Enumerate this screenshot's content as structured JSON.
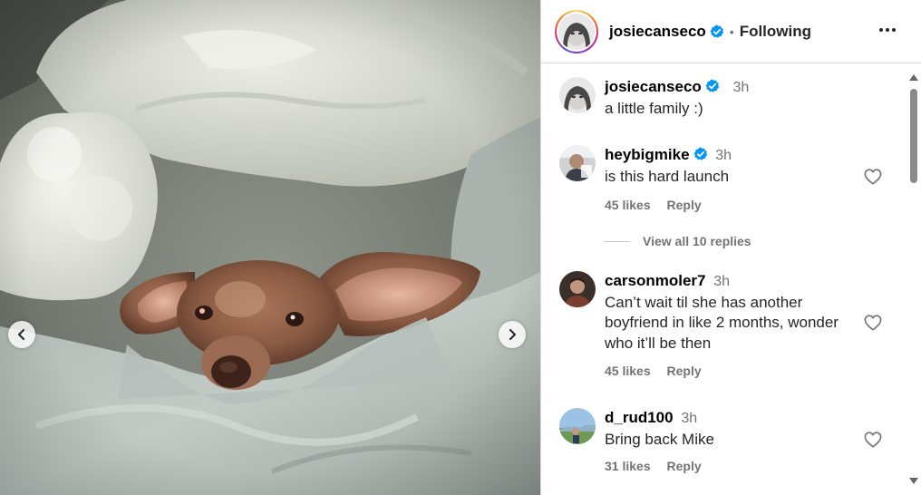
{
  "header": {
    "username": "josiecanseco",
    "separator": "•",
    "follow_label": "Following"
  },
  "caption": {
    "username": "josiecanseco",
    "time": "3h",
    "text": "a little family :)"
  },
  "comments": [
    {
      "username": "heybigmike",
      "verified": true,
      "time": "3h",
      "text": "is this hard launch",
      "likes": "45 likes",
      "reply_label": "Reply"
    },
    {
      "username": "carsonmoler7",
      "verified": false,
      "time": "3h",
      "text": "Can’t wait til she has another boyfriend in like 2 months, wonder who it’ll be then",
      "likes": "45 likes",
      "reply_label": "Reply"
    },
    {
      "username": "d_rud100",
      "verified": false,
      "time": "3h",
      "text": "Bring back Mike",
      "likes": "31 likes",
      "reply_label": "Reply"
    }
  ],
  "view_replies_label": "View all 10 replies",
  "colors": {
    "verified_blue": "#0095f6",
    "secondary_text": "#737373",
    "divider": "#dbdbdb"
  },
  "icons": [
    "verified-badge-icon",
    "more-options-icon",
    "heart-icon",
    "chevron-left-icon",
    "chevron-right-icon"
  ]
}
